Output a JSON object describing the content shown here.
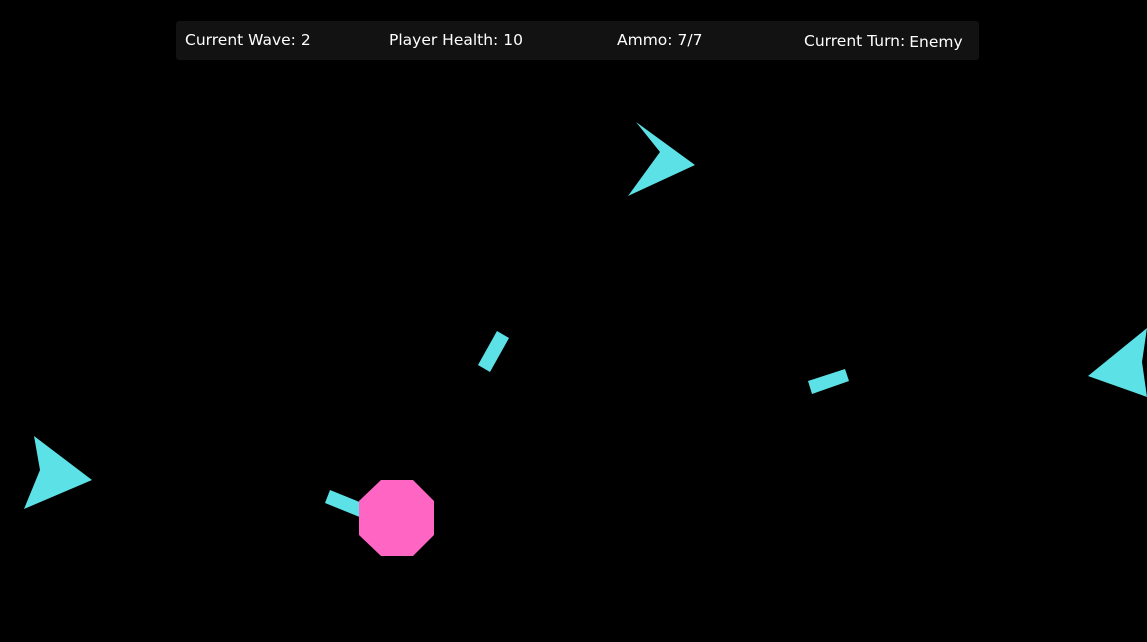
{
  "hud": {
    "wave_label": "Current Wave:",
    "wave_value": "2",
    "health_label": "Player Health:",
    "health_value": "10",
    "ammo_label": "Ammo:",
    "ammo_value": "7/7",
    "turn_label": "Current Turn:",
    "turn_value": "Enemy"
  },
  "colors": {
    "background": "#000000",
    "hud_panel": "#121212",
    "hud_text": "#ffffff",
    "enemy": "#5ce1e6",
    "projectile": "#5ce1e6",
    "player": "#ff66c4",
    "player_barrel": "#5ce1e6"
  },
  "entities": {
    "enemies": [
      {
        "name": "enemy-ship-top",
        "icon": "arrowhead-enemy-icon"
      },
      {
        "name": "enemy-ship-left",
        "icon": "arrowhead-enemy-icon"
      },
      {
        "name": "enemy-ship-right-edge",
        "icon": "arrowhead-enemy-icon"
      }
    ],
    "projectiles": [
      {
        "name": "enemy-projectile-center"
      },
      {
        "name": "enemy-projectile-right"
      }
    ],
    "player": {
      "name": "player-octagon",
      "icon": "octagon-player-icon"
    }
  }
}
